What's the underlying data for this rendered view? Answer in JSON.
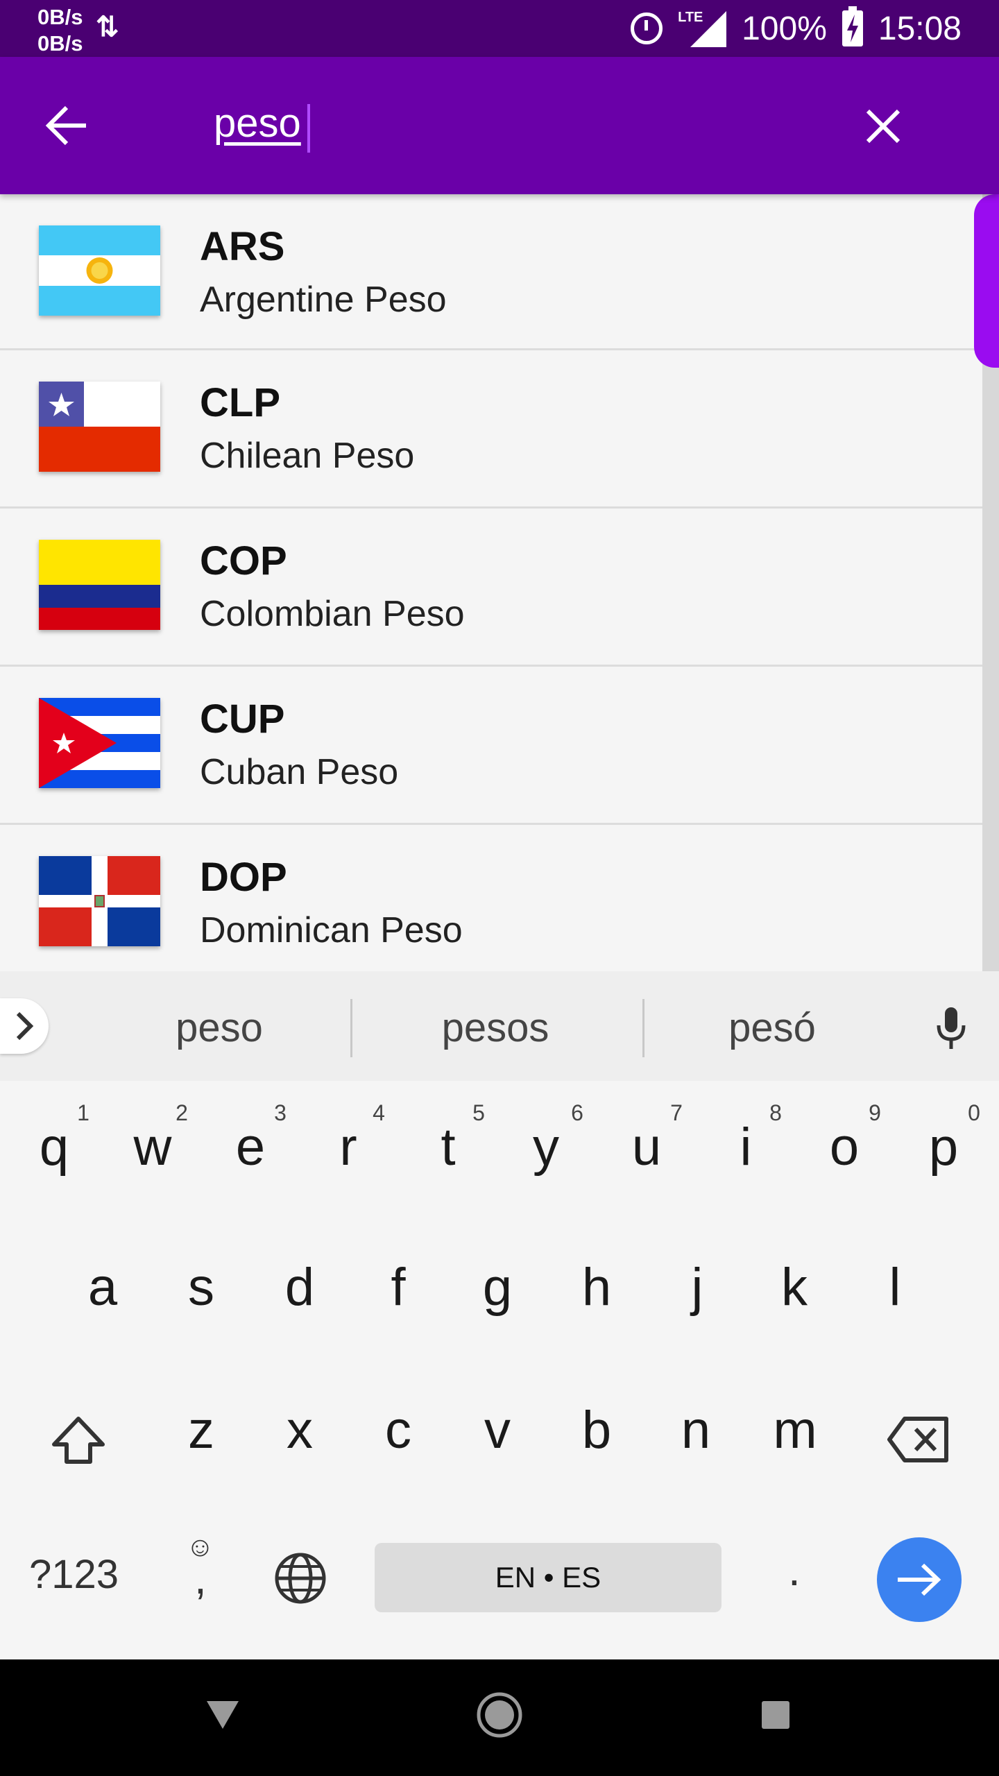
{
  "status_bar": {
    "net_up": "0B/s",
    "net_down": "0B/s",
    "network_type": "LTE",
    "battery": "100%",
    "time": "15:08"
  },
  "search": {
    "query": "peso"
  },
  "results": [
    {
      "code": "ARS",
      "name": "Argentine Peso"
    },
    {
      "code": "CLP",
      "name": "Chilean Peso"
    },
    {
      "code": "COP",
      "name": "Colombian Peso"
    },
    {
      "code": "CUP",
      "name": "Cuban Peso"
    },
    {
      "code": "DOP",
      "name": "Dominican Peso"
    }
  ],
  "keyboard": {
    "suggestions": [
      "peso",
      "pesos",
      "pesó"
    ],
    "row1": [
      "q",
      "w",
      "e",
      "r",
      "t",
      "y",
      "u",
      "i",
      "o",
      "p"
    ],
    "row1_hints": [
      "1",
      "2",
      "3",
      "4",
      "5",
      "6",
      "7",
      "8",
      "9",
      "0"
    ],
    "row2": [
      "a",
      "s",
      "d",
      "f",
      "g",
      "h",
      "j",
      "k",
      "l"
    ],
    "row3": [
      "z",
      "x",
      "c",
      "v",
      "b",
      "n",
      "m"
    ],
    "symbols_label": "?123",
    "comma_label": ",",
    "space_label": "EN • ES",
    "period_label": "."
  },
  "colors": {
    "status_bar": "#4a0072",
    "app_bar": "#6a00a8",
    "accent": "#9a0cf0",
    "enter_key": "#3b82f0"
  }
}
